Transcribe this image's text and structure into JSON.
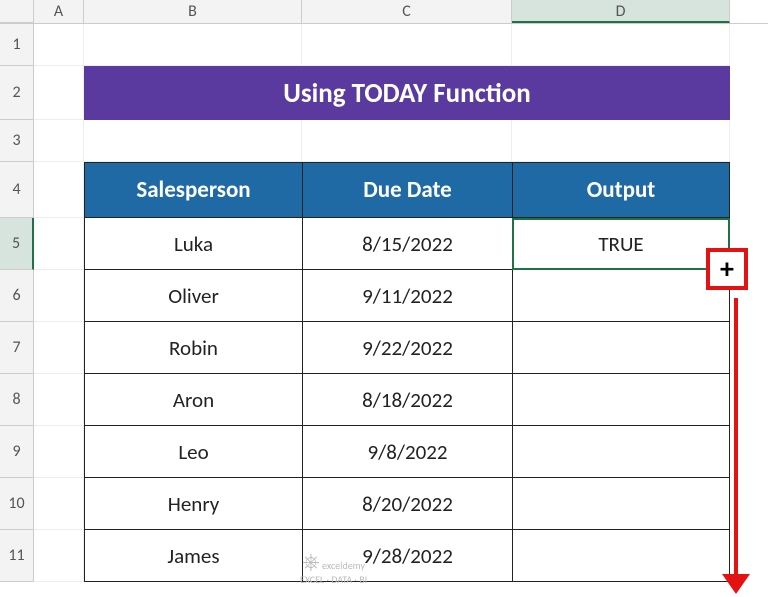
{
  "columns": {
    "A": "A",
    "B": "B",
    "C": "C",
    "D": "D"
  },
  "rows": {
    "1": "1",
    "2": "2",
    "3": "3",
    "4": "4",
    "5": "5",
    "6": "6",
    "7": "7",
    "8": "8",
    "9": "9",
    "10": "10",
    "11": "11"
  },
  "title": "Using TODAY Function",
  "headers": {
    "salesperson": "Salesperson",
    "duedate": "Due Date",
    "output": "Output"
  },
  "data": [
    {
      "name": "Luka",
      "date": "8/15/2022",
      "out": "TRUE"
    },
    {
      "name": "Oliver",
      "date": "9/11/2022",
      "out": ""
    },
    {
      "name": "Robin",
      "date": "9/22/2022",
      "out": ""
    },
    {
      "name": "Aron",
      "date": "8/18/2022",
      "out": ""
    },
    {
      "name": "Leo",
      "date": "9/8/2022",
      "out": ""
    },
    {
      "name": "Henry",
      "date": "8/20/2022",
      "out": ""
    },
    {
      "name": "James",
      "date": "9/28/2022",
      "out": ""
    }
  ],
  "fillhandle": "+",
  "watermark": {
    "brand": "exceldemy",
    "sub": "EXCEL · DATA · BI"
  }
}
